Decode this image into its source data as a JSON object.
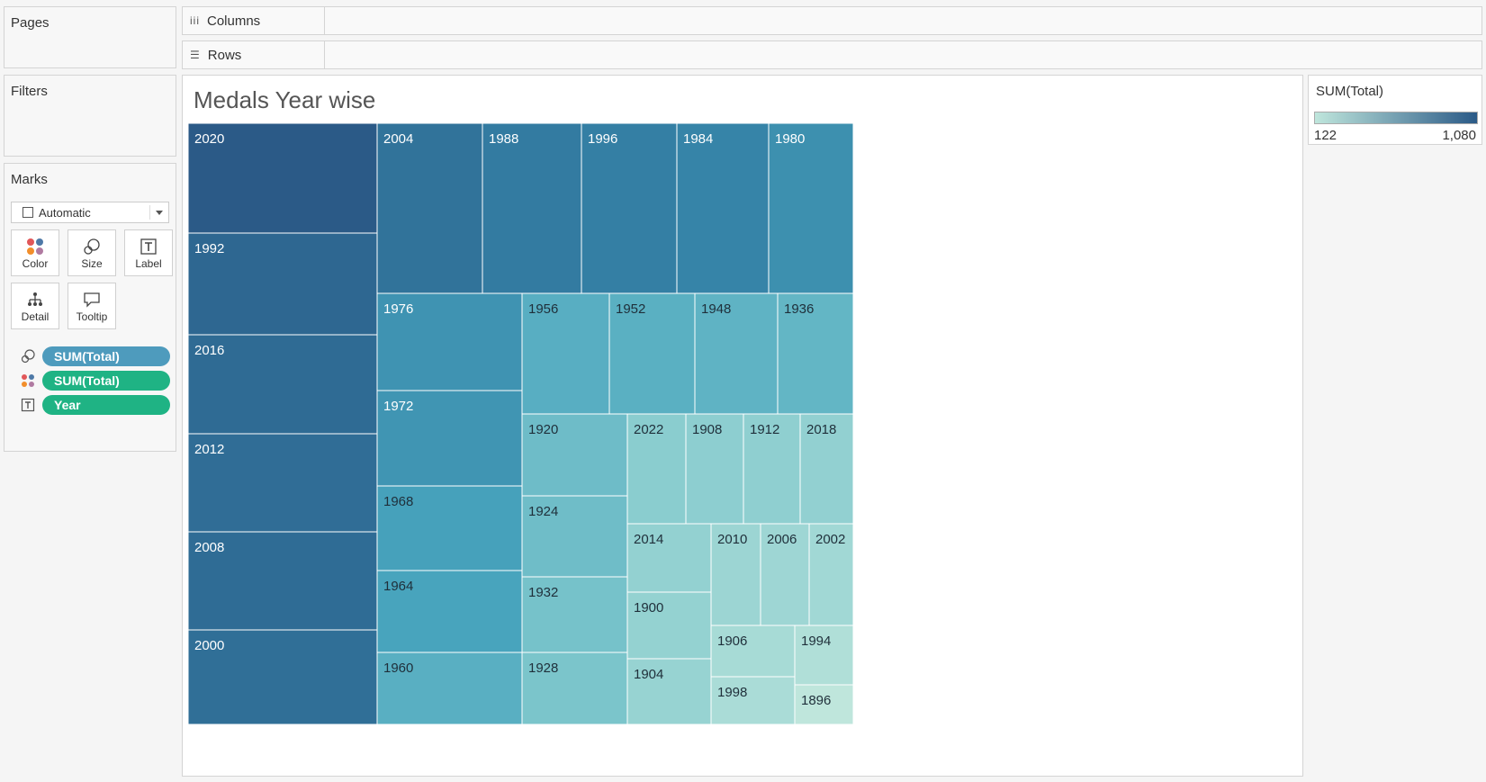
{
  "panels": {
    "pages": "Pages",
    "filters": "Filters",
    "marks": "Marks"
  },
  "shelves": {
    "columns": "Columns",
    "rows": "Rows"
  },
  "marks": {
    "type": "Automatic",
    "buttons": [
      "Color",
      "Size",
      "Label",
      "Detail",
      "Tooltip"
    ],
    "pills": [
      {
        "icon": "size-icon",
        "label": "SUM(Total)",
        "color": "#4e9bbd"
      },
      {
        "icon": "color-icon",
        "label": "SUM(Total)",
        "color": "#1fb384"
      },
      {
        "icon": "label-icon",
        "label": "Year",
        "color": "#1fb384"
      }
    ]
  },
  "legend": {
    "title": "SUM(Total)",
    "min_label": "122",
    "max_label": "1,080",
    "color_low": "#bfe6dc",
    "color_high": "#2b5a87"
  },
  "chart_data": {
    "type": "treemap",
    "title": "Medals Year wise",
    "size_measure": "SUM(Total)",
    "label_field": "Year",
    "color_range": [
      122,
      1080
    ],
    "items": [
      {
        "label": "2020",
        "value": 1080
      },
      {
        "label": "1992",
        "value": 1000
      },
      {
        "label": "2016",
        "value": 975
      },
      {
        "label": "2012",
        "value": 960
      },
      {
        "label": "2008",
        "value": 965
      },
      {
        "label": "2000",
        "value": 950
      },
      {
        "label": "2004",
        "value": 925
      },
      {
        "label": "1988",
        "value": 875
      },
      {
        "label": "1996",
        "value": 845
      },
      {
        "label": "1984",
        "value": 815
      },
      {
        "label": "1980",
        "value": 740
      },
      {
        "label": "1976",
        "value": 720
      },
      {
        "label": "1972",
        "value": 705
      },
      {
        "label": "1968",
        "value": 630
      },
      {
        "label": "1964",
        "value": 610
      },
      {
        "label": "1960",
        "value": 535
      },
      {
        "label": "1956",
        "value": 540
      },
      {
        "label": "1952",
        "value": 530
      },
      {
        "label": "1948",
        "value": 510
      },
      {
        "label": "1936",
        "value": 490
      },
      {
        "label": "1920",
        "value": 445
      },
      {
        "label": "1924",
        "value": 440
      },
      {
        "label": "1932",
        "value": 410
      },
      {
        "label": "1928",
        "value": 390
      },
      {
        "label": "2022",
        "value": 330
      },
      {
        "label": "1908",
        "value": 320
      },
      {
        "label": "1912",
        "value": 310
      },
      {
        "label": "2018",
        "value": 300
      },
      {
        "label": "2014",
        "value": 295
      },
      {
        "label": "1900",
        "value": 290
      },
      {
        "label": "1904",
        "value": 280
      },
      {
        "label": "2010",
        "value": 260
      },
      {
        "label": "2006",
        "value": 252
      },
      {
        "label": "2002",
        "value": 240
      },
      {
        "label": "1906",
        "value": 215
      },
      {
        "label": "1998",
        "value": 205
      },
      {
        "label": "1994",
        "value": 180
      },
      {
        "label": "1896",
        "value": 122
      }
    ]
  }
}
